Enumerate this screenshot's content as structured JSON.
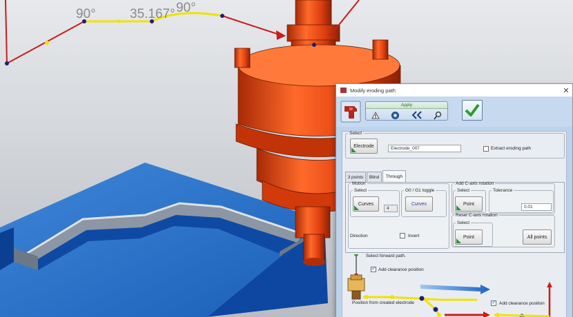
{
  "viewport": {
    "dimension_labels": [
      "90°",
      "35.167°",
      "90°"
    ]
  },
  "dialog": {
    "title": "Modify eroding path",
    "close_glyph": "✕",
    "toolbar": {
      "apply_label": "Apply",
      "icons": [
        "warning-icon",
        "gear-icon",
        "back-arrows-icon",
        "search-icon"
      ]
    },
    "select_group": {
      "legend": "Select",
      "electrode_button": "Electrode",
      "electrode_value": "Electrode_007",
      "extract_label": "Extract eroding path",
      "extract_checked": false
    },
    "tabs": [
      {
        "label": "3 points",
        "active": false
      },
      {
        "label": "Blind",
        "active": false
      },
      {
        "label": "Through",
        "active": true
      }
    ],
    "motion": {
      "legend": "Motion",
      "select_legend": "Select",
      "curves_button": "Curves",
      "curves_count": "4",
      "g0_legend": "G0 / G1 toggle",
      "g0_button": "Curves",
      "direction_label": "Direction",
      "invert_label": "Invert",
      "invert_checked": false
    },
    "c_axis": {
      "legend": "Add C-axis rotation",
      "select_legend": "Select",
      "point_button": "Point",
      "tolerance_legend": "Tolerance",
      "tolerance_value": "0.01"
    },
    "reset_c_axis": {
      "legend": "Reset C-axis rotation",
      "select_legend": "Select",
      "point_button": "Point",
      "all_points_button": "All points"
    },
    "diagram": {
      "select_forward": "Select forward path.",
      "add_clearance_1": "Add clearance position",
      "position_from_electrode": "Position from created electrode",
      "add_clearance_2": "Add clearance position",
      "clearance_1_checked": true,
      "clearance_2_checked": true
    }
  },
  "colors": {
    "spindle": "#e8420f",
    "block": "#1565c0",
    "path_yellow": "#f2e200",
    "path_red": "#cc1b1b",
    "dialog_blue": "#bcd3ed",
    "accent_green": "#2f8f3a"
  }
}
